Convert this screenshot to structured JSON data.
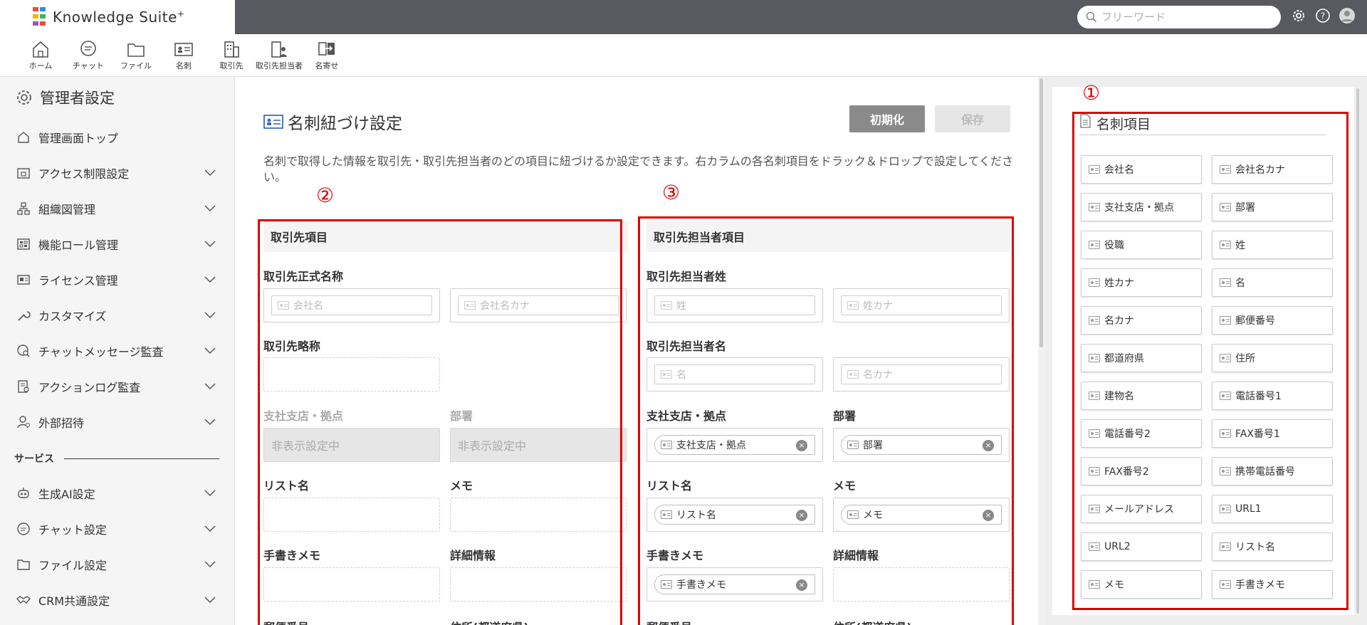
{
  "app": {
    "logo_text": "Knowledge Suite",
    "logo_sup": "+",
    "logo_colors": [
      "#e94e3c",
      "#2e8de6",
      "#f4b400",
      "#3bb273",
      "#9b59b6",
      "#e94e3c"
    ]
  },
  "search": {
    "placeholder": "フリーワード"
  },
  "topbar": {
    "icons": [
      "gear-icon",
      "help-icon",
      "avatar"
    ]
  },
  "appbar": {
    "items": [
      {
        "label": "ホーム",
        "icon": "home-icon"
      },
      {
        "label": "チャット",
        "icon": "chat-icon"
      },
      {
        "label": "ファイル",
        "icon": "folder-icon"
      },
      {
        "label": "名刺",
        "icon": "business-card-icon"
      },
      {
        "label": "取引先",
        "icon": "building-icon"
      },
      {
        "label": "取引先担当者",
        "icon": "contact-person-icon"
      },
      {
        "label": "名寄せ",
        "icon": "merge-icon"
      }
    ]
  },
  "sidebar": {
    "title": "管理者設定",
    "items": [
      {
        "label": "管理画面トップ",
        "icon": "home-icon",
        "expandable": false
      },
      {
        "label": "アクセス制限設定",
        "icon": "lock-icon",
        "expandable": true
      },
      {
        "label": "組織図管理",
        "icon": "org-chart-icon",
        "expandable": true
      },
      {
        "label": "機能ロール管理",
        "icon": "role-icon",
        "expandable": true
      },
      {
        "label": "ライセンス管理",
        "icon": "license-icon",
        "expandable": true
      },
      {
        "label": "カスタマイズ",
        "icon": "wrench-icon",
        "expandable": true
      },
      {
        "label": "チャットメッセージ監査",
        "icon": "chat-audit-icon",
        "expandable": true
      },
      {
        "label": "アクションログ監査",
        "icon": "log-audit-icon",
        "expandable": true
      },
      {
        "label": "外部招待",
        "icon": "user-invite-icon",
        "expandable": true
      }
    ],
    "section_label": "サービス",
    "service_items": [
      {
        "label": "生成AI設定",
        "icon": "ai-robot-icon",
        "expandable": true
      },
      {
        "label": "チャット設定",
        "icon": "chat-icon",
        "expandable": true
      },
      {
        "label": "ファイル設定",
        "icon": "folder-icon",
        "expandable": true
      },
      {
        "label": "CRM共通設定",
        "icon": "handshake-icon",
        "expandable": true
      }
    ]
  },
  "main": {
    "title": "名刺紐づけ設定",
    "reset_label": "初期化",
    "save_label": "保存",
    "description": "名刺で取得した情報を取引先・取引先担当者のどの項目に紐づけるか設定できます。右カラムの各名刺項目をドラック＆ドロップで設定してください。",
    "markers": [
      "①",
      "②",
      "③"
    ],
    "account": {
      "header": "取引先項目",
      "fields": {
        "official_name": {
          "label": "取引先正式名称",
          "placeholders": [
            "会社名",
            "会社名カナ"
          ]
        },
        "short_name": {
          "label": "取引先略称"
        },
        "branch": {
          "label": "支社支店・拠点",
          "value": "非表示設定中"
        },
        "department": {
          "label": "部署",
          "value": "非表示設定中"
        },
        "list_name": {
          "label": "リスト名"
        },
        "memo": {
          "label": "メモ"
        },
        "handwritten_memo": {
          "label": "手書きメモ"
        },
        "details": {
          "label": "詳細情報"
        },
        "postal_code": {
          "label": "郵便番号"
        },
        "address_pref": {
          "label": "住所(都道府県)"
        }
      }
    },
    "contact": {
      "header": "取引先担当者項目",
      "fields": {
        "last_name": {
          "label": "取引先担当者姓",
          "placeholders": [
            "姓",
            "姓カナ"
          ]
        },
        "first_name": {
          "label": "取引先担当者名",
          "placeholders": [
            "名",
            "名カナ"
          ]
        },
        "branch": {
          "label": "支社支店・拠点",
          "chip": "支社支店・拠点"
        },
        "department": {
          "label": "部署",
          "chip": "部署"
        },
        "list_name": {
          "label": "リスト名",
          "chip": "リスト名"
        },
        "memo": {
          "label": "メモ",
          "chip": "メモ"
        },
        "handwritten_memo": {
          "label": "手書きメモ",
          "chip": "手書きメモ"
        },
        "details": {
          "label": "詳細情報"
        },
        "postal_code": {
          "label": "郵便番号"
        },
        "address_pref": {
          "label": "住所(都道府県)"
        }
      },
      "remove_glyph": "×"
    }
  },
  "card_items": {
    "title": "名刺項目",
    "items": [
      "会社名",
      "会社名カナ",
      "支社支店・拠点",
      "部署",
      "役職",
      "姓",
      "姓カナ",
      "名",
      "名カナ",
      "郵便番号",
      "都道府県",
      "住所",
      "建物名",
      "電話番号1",
      "電話番号2",
      "FAX番号1",
      "FAX番号2",
      "携帯電話番号",
      "メールアドレス",
      "URL1",
      "URL2",
      "リスト名",
      "メモ",
      "手書きメモ"
    ]
  },
  "colors": {
    "highlight": "#e00000",
    "topbar": "#595a5f",
    "reset_button": "#8a8a8a"
  }
}
